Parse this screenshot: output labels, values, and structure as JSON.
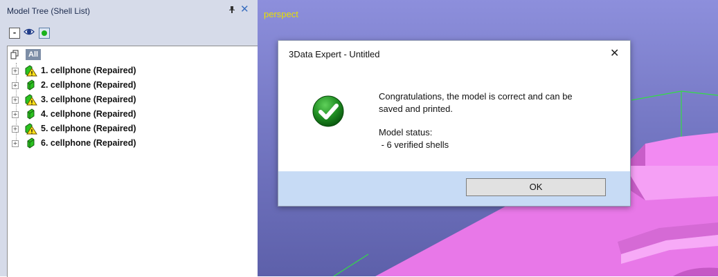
{
  "panel": {
    "title": "Model Tree (Shell List)",
    "pin_glyph": "ᵖ",
    "close_glyph": "✕",
    "toolbar": {
      "collapse_glyph": "-",
      "icons": [
        "collapse-icon",
        "eye-icon",
        "green-dot-icon"
      ]
    },
    "tree": {
      "root_label": "All",
      "items": [
        {
          "label": "1. cellphone (Repaired)",
          "icon": "warning-shell-icon"
        },
        {
          "label": "2. cellphone (Repaired)",
          "icon": "green-shell-icon"
        },
        {
          "label": "3. cellphone (Repaired)",
          "icon": "warning-shell-icon"
        },
        {
          "label": "4. cellphone (Repaired)",
          "icon": "green-shell-icon"
        },
        {
          "label": "5. cellphone (Repaired)",
          "icon": "warning-shell-icon"
        },
        {
          "label": "6. cellphone (Repaired)",
          "icon": "green-shell-icon"
        }
      ],
      "expander_glyph": "+"
    }
  },
  "viewport": {
    "label": "perspect"
  },
  "dialog": {
    "title": "3Data Expert - Untitled",
    "close_glyph": "✕",
    "message_line1": "Congratulations, the model is correct and can be",
    "message_line2": "saved and printed.",
    "status_heading": "Model status:",
    "status_line": " - 6 verified shells",
    "ok_label": "OK",
    "icon": "green-checkmark-icon"
  },
  "colors": {
    "panel_bg": "#d6dbe9",
    "viewport_top": "#8d8fdc",
    "viewport_bottom": "#5d60aa",
    "viewport_label": "#e8e000",
    "model_pink": "#f07ef0",
    "dialog_footer": "#c7dbf5",
    "wireframe_green": "#33dd44"
  }
}
